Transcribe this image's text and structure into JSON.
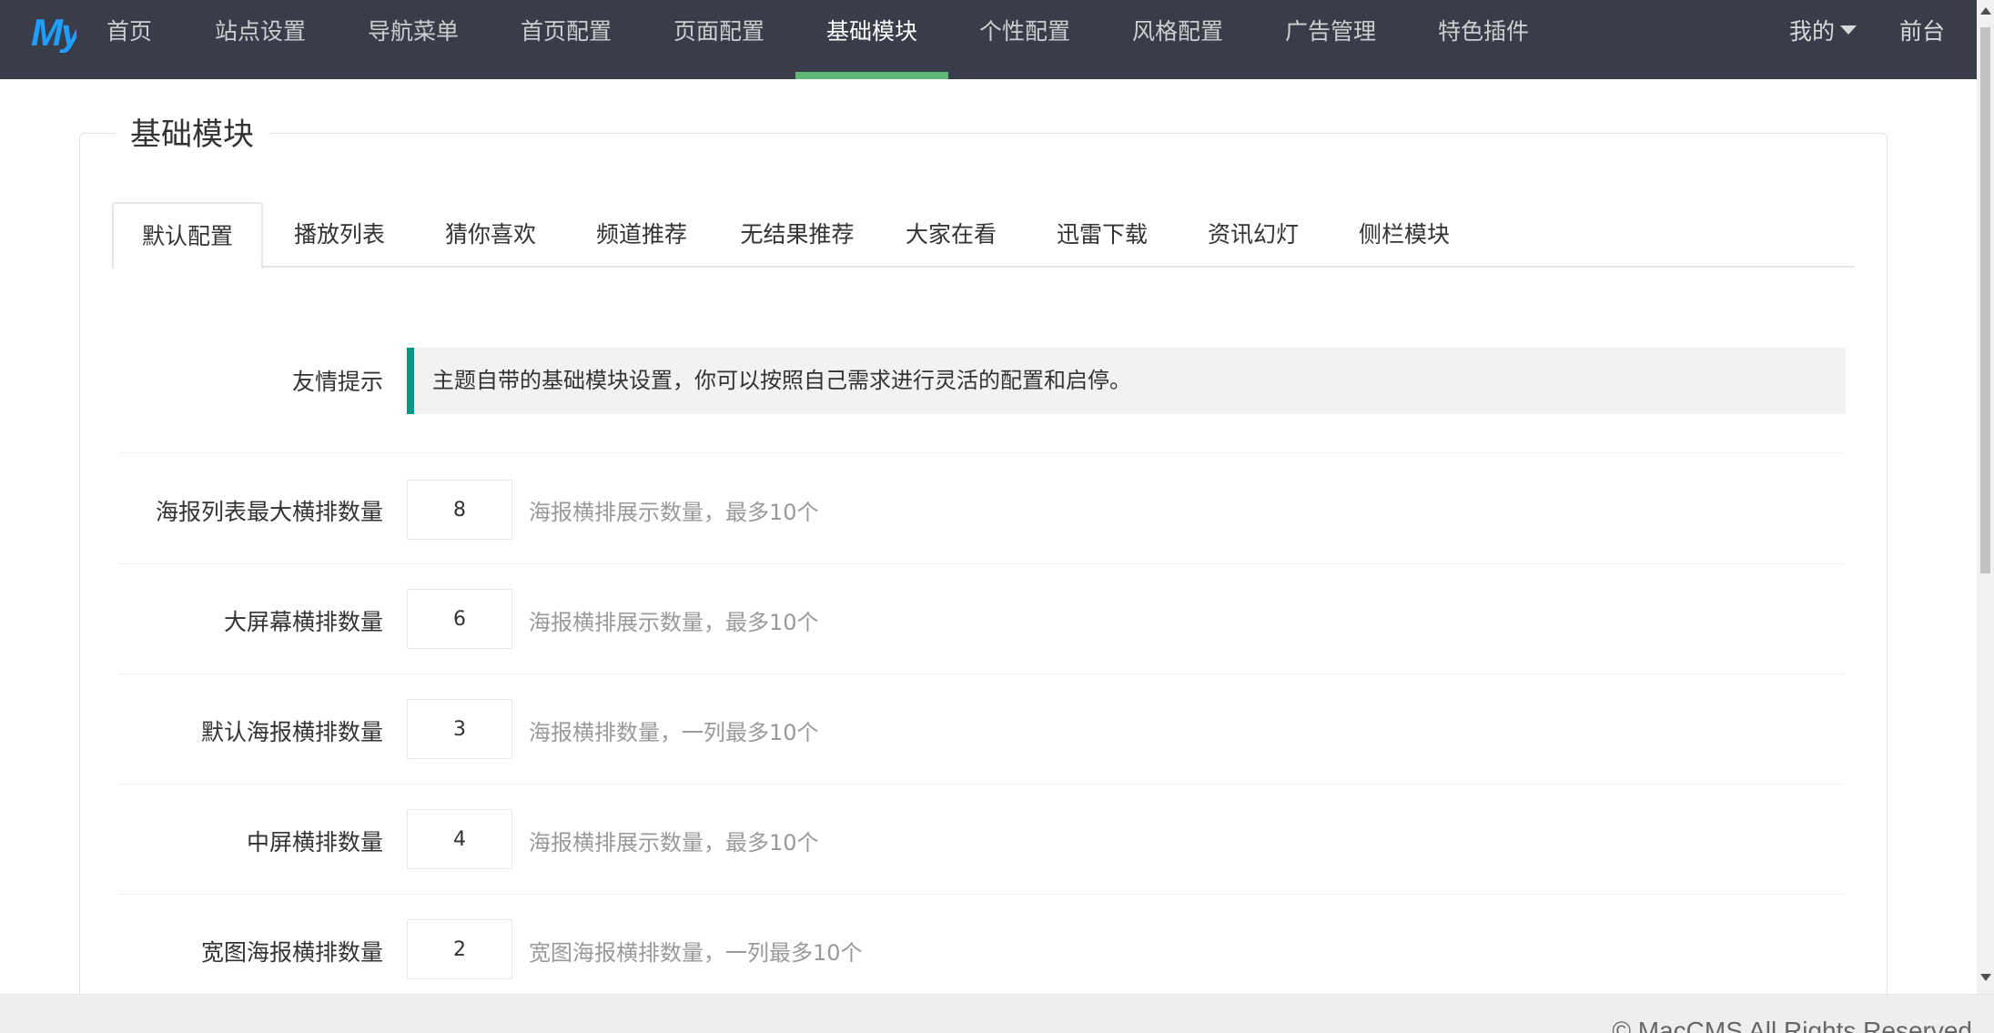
{
  "brand": {
    "logo_text": "My"
  },
  "nav": {
    "items": [
      {
        "label": "首页"
      },
      {
        "label": "站点设置"
      },
      {
        "label": "导航菜单"
      },
      {
        "label": "首页配置"
      },
      {
        "label": "页面配置"
      },
      {
        "label": "基础模块",
        "active": true
      },
      {
        "label": "个性配置"
      },
      {
        "label": "风格配置"
      },
      {
        "label": "广告管理"
      },
      {
        "label": "特色插件"
      }
    ],
    "user_menu": "我的",
    "frontend_link": "前台"
  },
  "panel": {
    "title": "基础模块"
  },
  "tabs": [
    {
      "label": "默认配置",
      "active": true
    },
    {
      "label": "播放列表"
    },
    {
      "label": "猜你喜欢"
    },
    {
      "label": "频道推荐"
    },
    {
      "label": "无结果推荐"
    },
    {
      "label": "大家在看"
    },
    {
      "label": "迅雷下载"
    },
    {
      "label": "资讯幻灯"
    },
    {
      "label": "侧栏模块"
    }
  ],
  "tip": {
    "label": "友情提示",
    "text": "主题自带的基础模块设置，你可以按照自己需求进行灵活的配置和启停。"
  },
  "form_rows": [
    {
      "label": "海报列表最大横排数量",
      "value": "8",
      "hint": "海报横排展示数量，最多10个"
    },
    {
      "label": "大屏幕横排数量",
      "value": "6",
      "hint": "海报横排展示数量，最多10个"
    },
    {
      "label": "默认海报横排数量",
      "value": "3",
      "hint": "海报横排数量，一列最多10个"
    },
    {
      "label": "中屏横排数量",
      "value": "4",
      "hint": "海报横排展示数量，最多10个"
    },
    {
      "label": "宽图海报横排数量",
      "value": "2",
      "hint": "宽图海报横排数量，一列最多10个"
    }
  ],
  "footer": {
    "copyright": "© MacCMS All Rights Reserved"
  },
  "colors": {
    "nav_bg": "#393d49",
    "nav_active_underline": "#5fb878",
    "tip_accent": "#009688",
    "logo": "#1e9fff"
  }
}
